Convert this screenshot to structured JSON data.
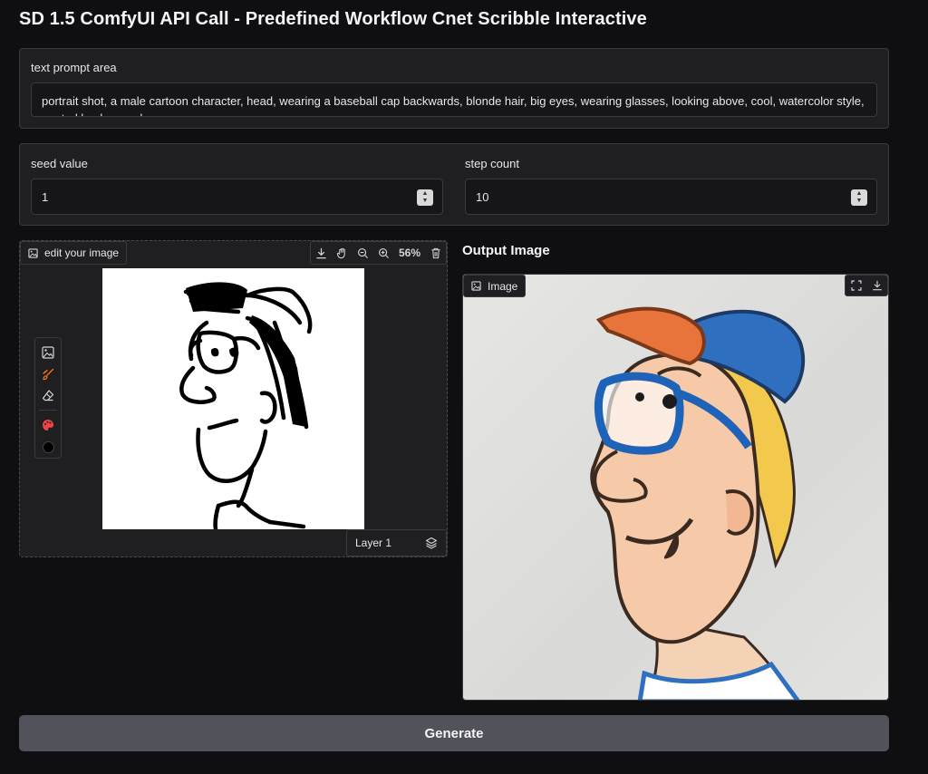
{
  "title": "SD 1.5 ComfyUI API Call - Predefined Workflow Cnet Scribble Interactive",
  "prompt": {
    "label": "text prompt area",
    "value": "portrait shot, a male cartoon character, head, wearing a baseball cap backwards, blonde hair, big eyes, wearing glasses, looking above,  cool, watercolor style, neutral background"
  },
  "seed": {
    "label": "seed value",
    "value": "1"
  },
  "steps": {
    "label": "step count",
    "value": "10"
  },
  "editor": {
    "label": "edit your image",
    "zoom": "56%",
    "layer_label": "Layer 1"
  },
  "output": {
    "title": "Output Image",
    "label": "Image"
  },
  "generate_label": "Generate",
  "icons": {
    "download": "download-icon",
    "pan": "hand-icon",
    "zoom_out": "zoom-out-icon",
    "zoom_in": "zoom-in-icon",
    "delete": "trash-icon",
    "image": "image-icon",
    "brush": "brush-icon",
    "eraser": "eraser-icon",
    "palette": "palette-icon",
    "color": "color-swatch-icon",
    "layers": "layers-icon",
    "fullscreen": "fullscreen-icon"
  },
  "colors": {
    "brush_tool": "#f97316",
    "palette": "#ef4444",
    "brush_color": "#000000",
    "generate_button": "#52525b"
  }
}
